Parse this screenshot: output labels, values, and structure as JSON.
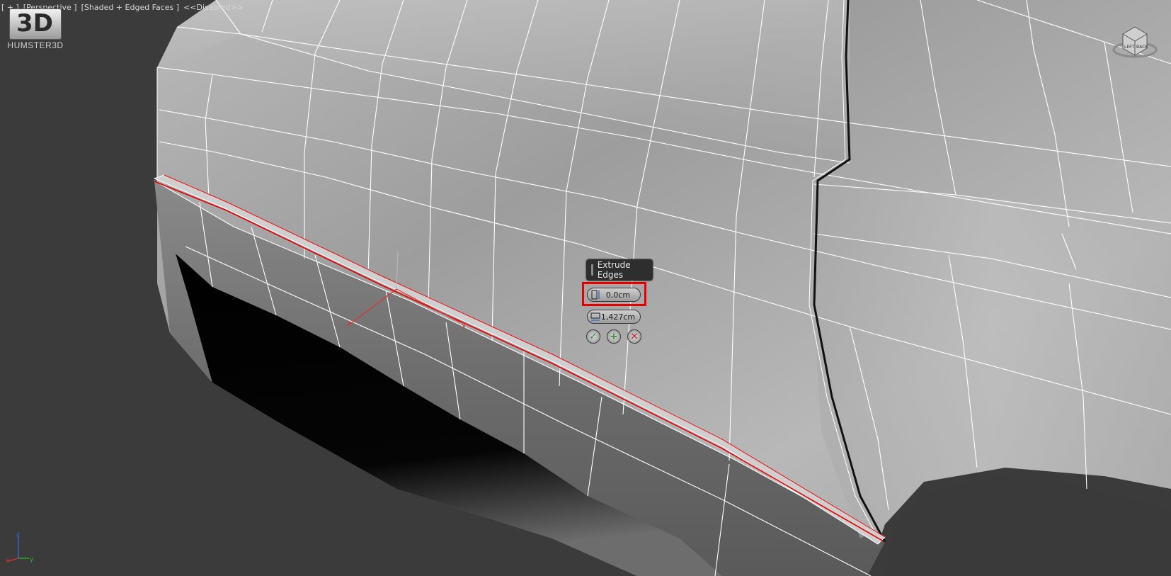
{
  "viewport": {
    "label_plus": "[ + ]",
    "label_view": "[Perspective ]",
    "label_shading": "[Shaded + Edged Faces ]",
    "label_disabled": "<<Disabled>>"
  },
  "logo": {
    "mark": "3D",
    "brand": "HUMSTER3D"
  },
  "viewcube": {
    "left_face": "LEFT",
    "back_face": "BACK"
  },
  "caddy": {
    "title": "Extrude Edges",
    "height_value": "0,0cm",
    "width_value": "1,427cm",
    "ok_symbol": "✓",
    "apply_symbol": "+",
    "cancel_symbol": "✕"
  },
  "gizmo": {
    "x_label": "x",
    "y_label": "y"
  },
  "axis": {
    "x": "x",
    "y": "y",
    "z": "z"
  },
  "colors": {
    "viewport_bg": "#3b3b3b",
    "selection_edge": "#e60000",
    "caddy_highlight": "#e60000",
    "ok_green": "#2e8b2e",
    "cancel_red": "#c02020"
  }
}
